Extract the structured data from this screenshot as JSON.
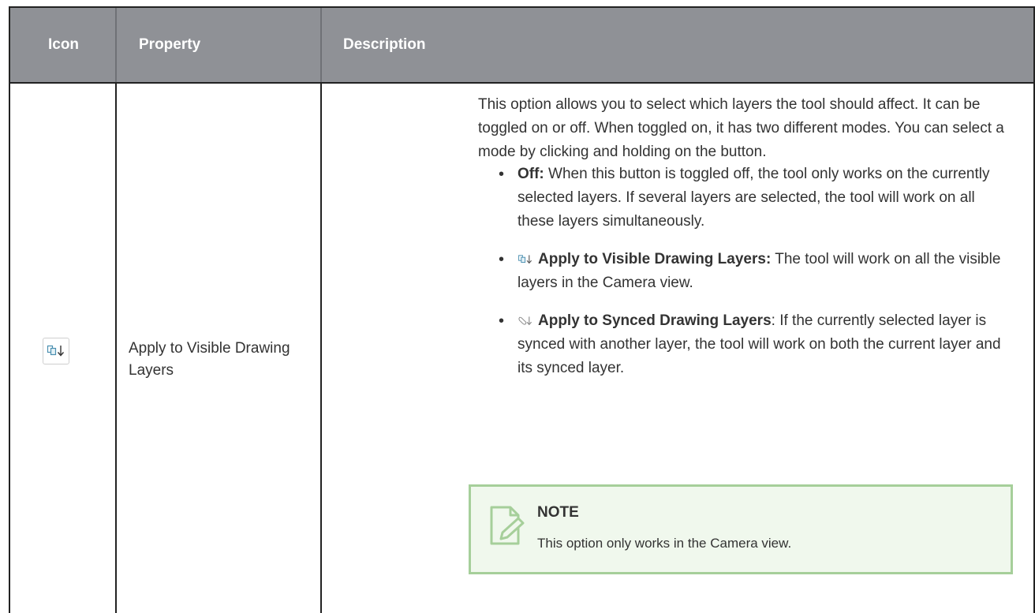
{
  "table": {
    "headers": {
      "icon": "Icon",
      "property": "Property",
      "description": "Description"
    },
    "row": {
      "icon_name": "apply-to-visible-drawing-layers-icon",
      "property": "Apply to Visible Drawing Layers",
      "intro": "This option allows you to select which layers the tool should affect. It can be toggled on or off. When toggled on, it has two different modes. You can select a mode by clicking and holding on the button.",
      "bullets": [
        {
          "label": "Off:",
          "text": " When this button is toggled off, the tool only works on the currently selected layers. If several layers are selected, the tool will work on all these layers simultaneously."
        },
        {
          "icon_name": "apply-to-visible-drawing-layers-icon",
          "label": "Apply to Visible Drawing Layers:",
          "text": " The tool will work on all the visible layers in the Camera view."
        },
        {
          "icon_name": "apply-to-synced-drawing-layers-icon",
          "label": "Apply to Synced Drawing Layers",
          "text": ": If the currently selected layer is synced with another layer, the tool will work on both the current layer and its synced layer."
        }
      ],
      "note": {
        "title": "NOTE",
        "text": "This option only works in the Camera view."
      }
    }
  },
  "colors": {
    "header_bg": "#8f9196",
    "note_bg": "#f0f8ed",
    "note_border": "#a6cf9a",
    "icon_blue": "#4a8fb0"
  }
}
